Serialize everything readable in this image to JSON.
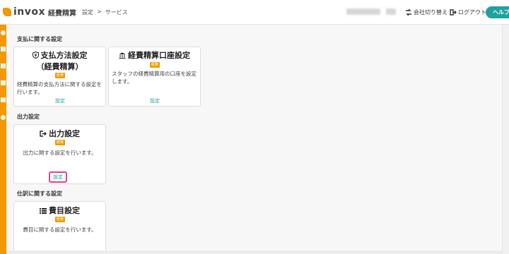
{
  "header": {
    "logo_text": "invox",
    "logo_sub": "経費精算",
    "breadcrumb": [
      "設定",
      ">",
      "サービス"
    ],
    "switch_company": "会社切り替え",
    "logout": "ログアウト",
    "help": "ヘルプ"
  },
  "sections": {
    "payment": "支払に関する設定",
    "output": "出力設定",
    "journal": "仕訳に関する設定"
  },
  "cards": {
    "payment_method": {
      "title_line1": "支払方法設定",
      "title_line2": "（経費精算）",
      "badge": "経費",
      "desc": "経費精算の支払方法に関する設定を行います。",
      "link": "設定",
      "icon": "shield-yen-icon"
    },
    "bank_account": {
      "title": "経費精算口座設定",
      "badge": "経費",
      "desc": "スタッフの経費精算用の口座を設定します。",
      "link": "設定",
      "icon": "bank-icon"
    },
    "output": {
      "title": "出力設定",
      "badge": "経費",
      "desc": "出力に関する設定を行います。",
      "link": "設定",
      "icon": "export-icon"
    },
    "expense_item": {
      "title": "費目設定",
      "badge": "経費",
      "desc": "費目に関する設定を行います。",
      "icon": "list-icon"
    }
  },
  "colors": {
    "brand": "#f39800",
    "accent": "#21a0a0",
    "highlight": "#e4418f"
  }
}
